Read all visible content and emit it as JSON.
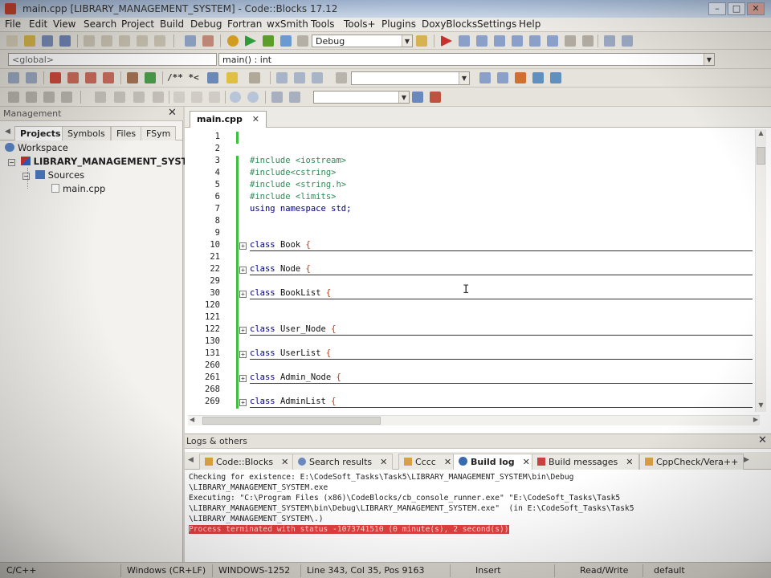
{
  "window": {
    "title": "main.cpp [LIBRARY_MANAGEMENT_SYSTEM] - Code::Blocks 17.12"
  },
  "menu": [
    "File",
    "Edit",
    "View",
    "Search",
    "Project",
    "Build",
    "Debug",
    "Fortran",
    "wxSmith",
    "Tools",
    "Tools+",
    "Plugins",
    "DoxyBlocks",
    "Settings",
    "Help"
  ],
  "toolbar": {
    "build_target": "Debug",
    "scope": "<global>",
    "function": "main() : int",
    "comment_markers": "/** *<"
  },
  "management": {
    "title": "Management",
    "tabs": [
      "Projects",
      "Symbols",
      "Files",
      "FSym"
    ],
    "active_tab": "Projects",
    "tree": {
      "workspace": "Workspace",
      "project": "LIBRARY_MANAGEMENT_SYSTEM",
      "folder": "Sources",
      "file": "main.cpp"
    }
  },
  "editor": {
    "tab": "main.cpp",
    "lines": [
      {
        "n": "1",
        "code": "",
        "kind": "blank"
      },
      {
        "n": "2",
        "code": "",
        "kind": "blank"
      },
      {
        "n": "3",
        "code": "#include <iostream>",
        "kind": "pp"
      },
      {
        "n": "4",
        "code": "#include<cstring>",
        "kind": "pp"
      },
      {
        "n": "5",
        "code": "#include <string.h>",
        "kind": "pp"
      },
      {
        "n": "6",
        "code": "#include <limits>",
        "kind": "pp"
      },
      {
        "n": "7",
        "code": "using namespace std;",
        "kind": "using"
      },
      {
        "n": "8",
        "code": "",
        "kind": "blank"
      },
      {
        "n": "9",
        "code": "",
        "kind": "blank"
      },
      {
        "n": "10",
        "code": "Book",
        "kind": "class"
      },
      {
        "n": "21",
        "code": "",
        "kind": "blank"
      },
      {
        "n": "22",
        "code": "Node",
        "kind": "class"
      },
      {
        "n": "29",
        "code": "",
        "kind": "blank"
      },
      {
        "n": "30",
        "code": "BookList",
        "kind": "class"
      },
      {
        "n": "120",
        "code": "",
        "kind": "blank"
      },
      {
        "n": "121",
        "code": "",
        "kind": "blank"
      },
      {
        "n": "122",
        "code": "User_Node",
        "kind": "class"
      },
      {
        "n": "130",
        "code": "",
        "kind": "blank"
      },
      {
        "n": "131",
        "code": "UserList",
        "kind": "class"
      },
      {
        "n": "260",
        "code": "",
        "kind": "blank"
      },
      {
        "n": "261",
        "code": "Admin_Node",
        "kind": "class"
      },
      {
        "n": "268",
        "code": "",
        "kind": "blank"
      },
      {
        "n": "269",
        "code": "AdminList",
        "kind": "class"
      }
    ]
  },
  "logs": {
    "title": "Logs & others",
    "tabs": [
      "Code::Blocks",
      "Search results",
      "Cccc",
      "Build log",
      "Build messages",
      "CppCheck/Vera++"
    ],
    "active_tab": "Build log",
    "lines": [
      "Checking for existence: E:\\CodeSoft_Tasks\\Task5\\LIBRARY_MANAGEMENT_SYSTEM\\bin\\Debug",
      "\\LIBRARY_MANAGEMENT_SYSTEM.exe",
      "Executing: \"C:\\Program Files (x86)\\CodeBlocks/cb_console_runner.exe\" \"E:\\CodeSoft_Tasks\\Task5",
      "\\LIBRARY_MANAGEMENT_SYSTEM\\bin\\Debug\\LIBRARY_MANAGEMENT_SYSTEM.exe\"  (in E:\\CodeSoft_Tasks\\Task5",
      "\\LIBRARY_MANAGEMENT_SYSTEM\\.)"
    ],
    "error_line": "Process terminated with status -1073741510 (0 minute(s), 2 second(s))"
  },
  "status": {
    "language": "C/C++",
    "eol": "Windows (CR+LF)",
    "encoding": "WINDOWS-1252",
    "position": "Line 343, Col 35, Pos 9163",
    "mode": "Insert",
    "access": "Read/Write",
    "profile": "default"
  },
  "colors": {
    "preprocessor": "#2e8b57",
    "keyword": "#00007f",
    "brace": "#cc3300",
    "change_bar": "#3fbf3f",
    "error_bg": "#e04040"
  }
}
